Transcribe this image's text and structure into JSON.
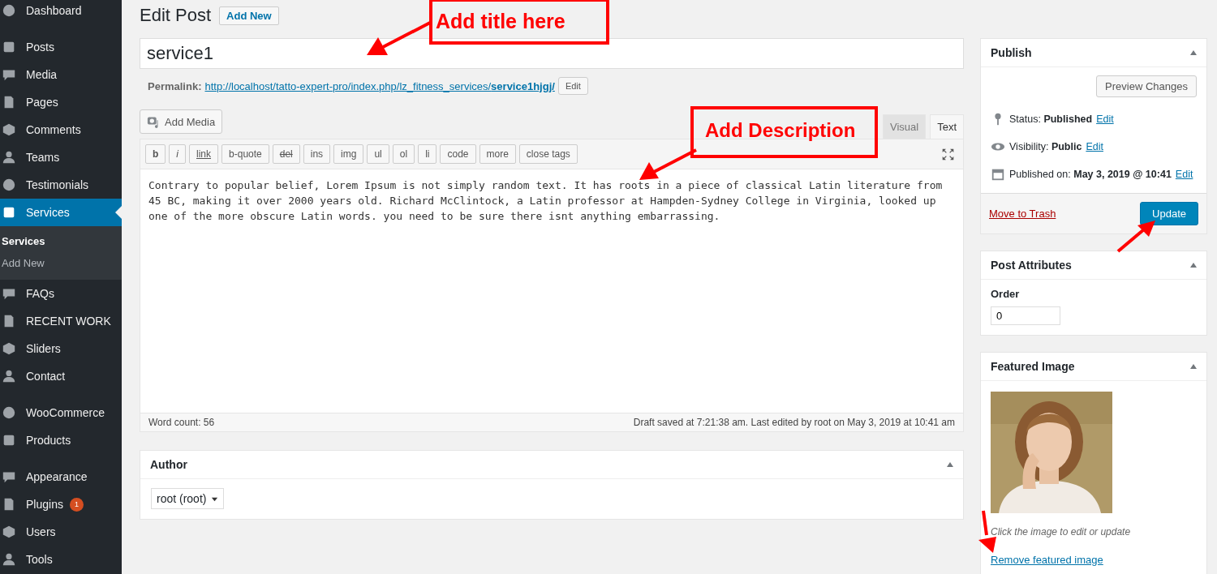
{
  "sidebar": {
    "groups": [
      {
        "items": [
          {
            "label": "Dashboard",
            "selected": false
          }
        ]
      },
      {
        "items": [
          {
            "label": "Posts",
            "selected": false
          },
          {
            "label": "Media",
            "selected": false
          },
          {
            "label": "Pages",
            "selected": false
          },
          {
            "label": "Comments",
            "selected": false
          },
          {
            "label": "Teams",
            "selected": false
          },
          {
            "label": "Testimonials",
            "selected": false
          },
          {
            "label": "Services",
            "selected": true,
            "children": [
              {
                "label": "Services",
                "selected": true
              },
              {
                "label": "Add New",
                "selected": false
              }
            ]
          },
          {
            "label": "FAQs",
            "selected": false
          },
          {
            "label": "RECENT WORK",
            "selected": false
          },
          {
            "label": "Sliders",
            "selected": false
          },
          {
            "label": "Contact",
            "selected": false
          }
        ]
      },
      {
        "items": [
          {
            "label": "WooCommerce",
            "selected": false
          },
          {
            "label": "Products",
            "selected": false
          }
        ]
      },
      {
        "items": [
          {
            "label": "Appearance",
            "selected": false
          },
          {
            "label": "Plugins",
            "selected": false,
            "badge": "1"
          },
          {
            "label": "Users",
            "selected": false
          },
          {
            "label": "Tools",
            "selected": false
          }
        ]
      }
    ]
  },
  "page": {
    "title": "Edit Post",
    "add_new": "Add New"
  },
  "post_title": {
    "value": "service1"
  },
  "permalink": {
    "label": "Permalink:",
    "url": "http://localhost/tatto-expert-pro/index.php/lz_fitness_services/",
    "slug": "service1hjgj/",
    "edit": "Edit"
  },
  "editor": {
    "add_media": "Add Media",
    "tabs": [
      {
        "label": "Visual",
        "selected": false
      },
      {
        "label": "Text",
        "selected": true
      }
    ],
    "quicktags": [
      "b",
      "i",
      "link",
      "b-quote",
      "del",
      "ins",
      "img",
      "ul",
      "ol",
      "li",
      "code",
      "more",
      "close tags"
    ],
    "content": "Contrary to popular belief, Lorem Ipsum is not simply random text. It has roots in a piece of classical Latin literature from 45 BC, making it over 2000 years old. Richard McClintock, a Latin professor at Hampden-Sydney College in Virginia, looked up one of the more obscure Latin words. you need to be sure there isnt anything embarrassing.",
    "word_count": "Word count: 56",
    "save_status": "Draft saved at 7:21:38 am. Last edited by root on May 3, 2019 at 10:41 am"
  },
  "author_box": {
    "title": "Author",
    "value": "root (root)"
  },
  "publish_box": {
    "title": "Publish",
    "preview": "Preview Changes",
    "rows": [
      {
        "label": "Status:",
        "value": "Published",
        "edit": "Edit"
      },
      {
        "label": "Visibility:",
        "value": "Public",
        "edit": "Edit"
      },
      {
        "label": "Published on:",
        "value": "May 3, 2019 @ 10:41",
        "edit": "Edit"
      }
    ],
    "trash": "Move to Trash",
    "update": "Update"
  },
  "attributes_box": {
    "title": "Post Attributes",
    "order_label": "Order",
    "order_value": "0"
  },
  "featured_box": {
    "title": "Featured Image",
    "hint": "Click the image to edit or update",
    "remove": "Remove featured image"
  },
  "annotations": [
    {
      "text": "Add title here"
    },
    {
      "text": "Add Description"
    }
  ]
}
